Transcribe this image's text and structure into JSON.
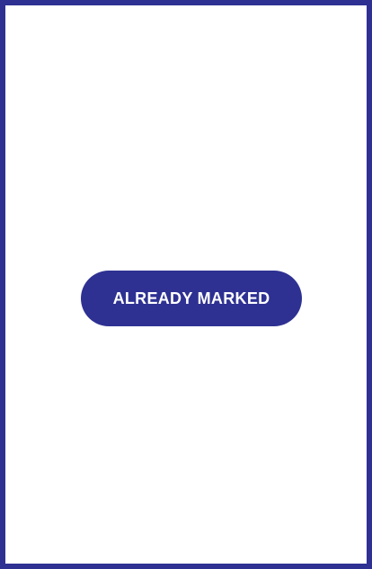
{
  "screen": {
    "frame_color": "#2e3192",
    "background_color": "#ffffff"
  },
  "status_button": {
    "label": "ALREADY MARKED",
    "background_color": "#2e3192",
    "text_color": "#ffffff"
  }
}
